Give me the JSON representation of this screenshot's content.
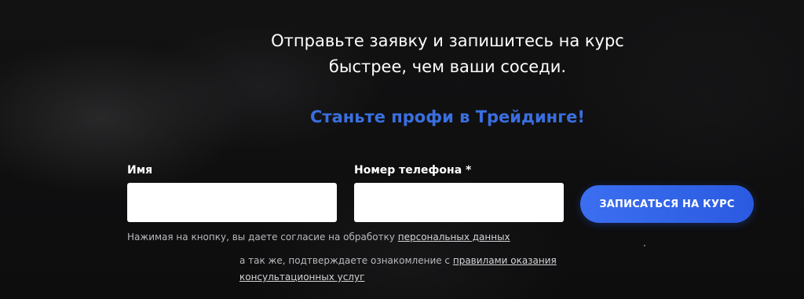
{
  "headline": {
    "line1": "Отправьте заявку и запишитесь на курс",
    "line2": "быстрее, чем ваши соседи."
  },
  "subheadline": "Станьте профи в Трейдинге!",
  "form": {
    "name_label": "Имя",
    "name_value": "",
    "phone_label": "Номер телефона *",
    "phone_value": "",
    "submit_label": "ЗАПИСАТЬСЯ НА КУРС"
  },
  "consent": {
    "line1_text": "Нажимая на кнопку, вы даете согласие на обработку ",
    "line1_link": "персональных данных",
    "line2_text": "а так же, подтверждаете ознакомление с ",
    "line2_link": "правилами оказания консультационных услуг"
  },
  "colors": {
    "accent": "#3a6fe0",
    "button": "#2f62e8",
    "background": "#0e0e0f"
  }
}
